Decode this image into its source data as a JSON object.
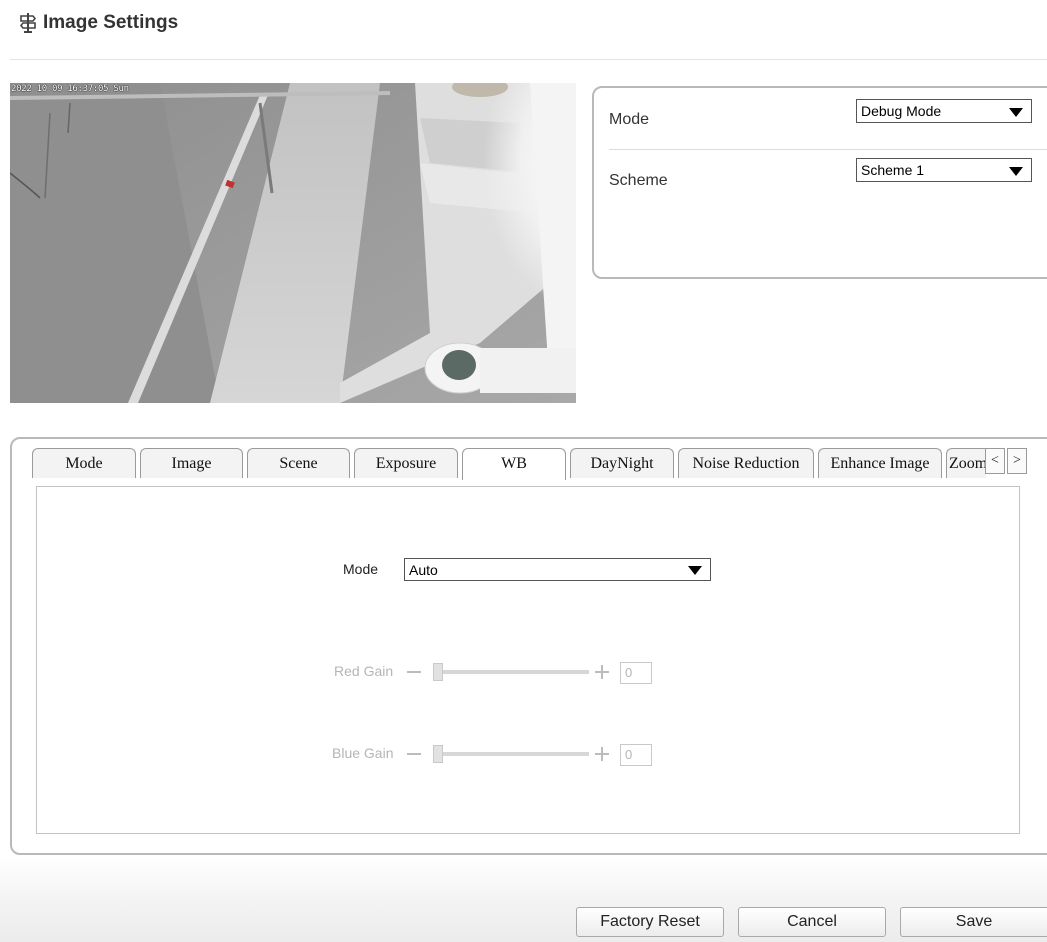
{
  "header": {
    "title": "Image Settings",
    "icon": "signpost-icon"
  },
  "video": {
    "osd_timestamp": "2022 10 09 16:37:05 Sun"
  },
  "mode_panel": {
    "mode_label": "Mode",
    "mode_value": "Debug Mode",
    "scheme_label": "Scheme",
    "scheme_value": "Scheme 1"
  },
  "tabs": {
    "items": [
      {
        "label": "Mode"
      },
      {
        "label": "Image"
      },
      {
        "label": "Scene"
      },
      {
        "label": "Exposure"
      },
      {
        "label": "WB"
      },
      {
        "label": "DayNight"
      },
      {
        "label": "Noise Reduction"
      },
      {
        "label": "Enhance Image"
      },
      {
        "label": "Zoom"
      }
    ],
    "active": "WB",
    "scroll_left": "<",
    "scroll_right": ">"
  },
  "wb": {
    "mode_label": "Mode",
    "mode_value": "Auto",
    "red_gain_label": "Red Gain",
    "red_gain_value": "0",
    "blue_gain_label": "Blue Gain",
    "blue_gain_value": "0"
  },
  "buttons": {
    "factory_reset": "Factory Reset",
    "cancel": "Cancel",
    "save": "Save"
  }
}
